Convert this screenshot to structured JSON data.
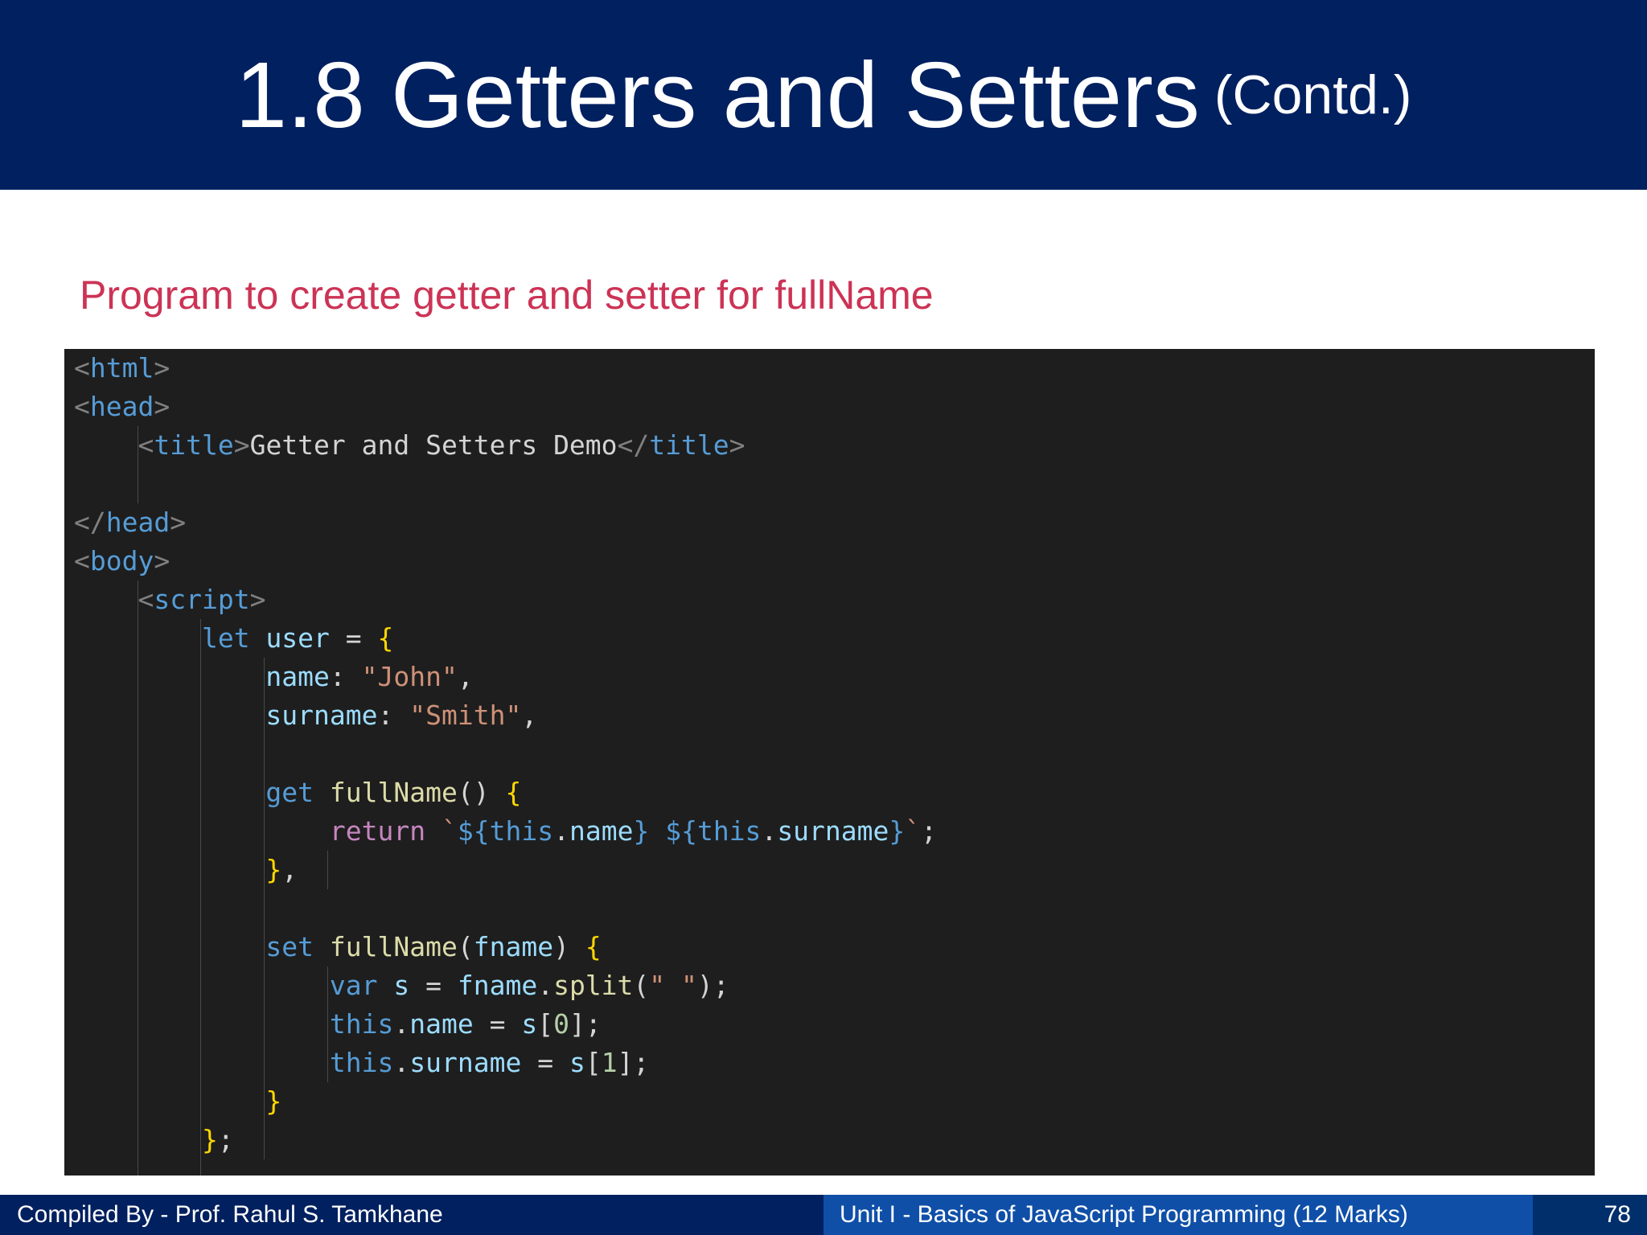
{
  "slide": {
    "title": "1.8 Getters and Setters",
    "title_suffix": "(Contd.)",
    "subtitle": "Program to create getter and setter for fullName"
  },
  "code": {
    "lines": [
      [
        {
          "t": "<",
          "c": "bracket"
        },
        {
          "t": "html",
          "c": "tag"
        },
        {
          "t": ">",
          "c": "bracket"
        }
      ],
      [
        {
          "t": "<",
          "c": "bracket"
        },
        {
          "t": "head",
          "c": "tag"
        },
        {
          "t": ">",
          "c": "bracket"
        }
      ],
      [
        {
          "t": "    ",
          "c": "text"
        },
        {
          "t": "<",
          "c": "bracket"
        },
        {
          "t": "title",
          "c": "tag"
        },
        {
          "t": ">",
          "c": "bracket"
        },
        {
          "t": "Getter and Setters Demo",
          "c": "text"
        },
        {
          "t": "</",
          "c": "bracket"
        },
        {
          "t": "title",
          "c": "tag"
        },
        {
          "t": ">",
          "c": "bracket"
        }
      ],
      [],
      [
        {
          "t": "</",
          "c": "bracket"
        },
        {
          "t": "head",
          "c": "tag"
        },
        {
          "t": ">",
          "c": "bracket"
        }
      ],
      [
        {
          "t": "<",
          "c": "bracket"
        },
        {
          "t": "body",
          "c": "tag"
        },
        {
          "t": ">",
          "c": "bracket"
        }
      ],
      [
        {
          "t": "    ",
          "c": "text"
        },
        {
          "t": "<",
          "c": "bracket"
        },
        {
          "t": "script",
          "c": "tag"
        },
        {
          "t": ">",
          "c": "bracket"
        }
      ],
      [
        {
          "t": "        ",
          "c": "text"
        },
        {
          "t": "let",
          "c": "kw"
        },
        {
          "t": " ",
          "c": "text"
        },
        {
          "t": "user",
          "c": "var"
        },
        {
          "t": " = ",
          "c": "punc"
        },
        {
          "t": "{",
          "c": "brace"
        }
      ],
      [
        {
          "t": "            ",
          "c": "text"
        },
        {
          "t": "name",
          "c": "var"
        },
        {
          "t": ": ",
          "c": "punc"
        },
        {
          "t": "\"John\"",
          "c": "str"
        },
        {
          "t": ",",
          "c": "punc"
        }
      ],
      [
        {
          "t": "            ",
          "c": "text"
        },
        {
          "t": "surname",
          "c": "var"
        },
        {
          "t": ": ",
          "c": "punc"
        },
        {
          "t": "\"Smith\"",
          "c": "str"
        },
        {
          "t": ",",
          "c": "punc"
        }
      ],
      [],
      [
        {
          "t": "            ",
          "c": "text"
        },
        {
          "t": "get",
          "c": "kw"
        },
        {
          "t": " ",
          "c": "text"
        },
        {
          "t": "fullName",
          "c": "fn"
        },
        {
          "t": "() ",
          "c": "punc"
        },
        {
          "t": "{",
          "c": "brace"
        }
      ],
      [
        {
          "t": "                ",
          "c": "text"
        },
        {
          "t": "return",
          "c": "ctrl"
        },
        {
          "t": " ",
          "c": "text"
        },
        {
          "t": "`",
          "c": "str"
        },
        {
          "t": "${",
          "c": "tpl"
        },
        {
          "t": "this",
          "c": "kw"
        },
        {
          "t": ".",
          "c": "punc"
        },
        {
          "t": "name",
          "c": "var"
        },
        {
          "t": "}",
          "c": "tpl"
        },
        {
          "t": " ",
          "c": "str"
        },
        {
          "t": "${",
          "c": "tpl"
        },
        {
          "t": "this",
          "c": "kw"
        },
        {
          "t": ".",
          "c": "punc"
        },
        {
          "t": "surname",
          "c": "var"
        },
        {
          "t": "}",
          "c": "tpl"
        },
        {
          "t": "`",
          "c": "str"
        },
        {
          "t": ";",
          "c": "punc"
        }
      ],
      [
        {
          "t": "            ",
          "c": "text"
        },
        {
          "t": "}",
          "c": "brace"
        },
        {
          "t": ",",
          "c": "punc"
        }
      ],
      [],
      [
        {
          "t": "            ",
          "c": "text"
        },
        {
          "t": "set",
          "c": "kw"
        },
        {
          "t": " ",
          "c": "text"
        },
        {
          "t": "fullName",
          "c": "fn"
        },
        {
          "t": "(",
          "c": "punc"
        },
        {
          "t": "fname",
          "c": "var"
        },
        {
          "t": ") ",
          "c": "punc"
        },
        {
          "t": "{",
          "c": "brace"
        }
      ],
      [
        {
          "t": "                ",
          "c": "text"
        },
        {
          "t": "var",
          "c": "kw"
        },
        {
          "t": " ",
          "c": "text"
        },
        {
          "t": "s",
          "c": "var"
        },
        {
          "t": " = ",
          "c": "punc"
        },
        {
          "t": "fname",
          "c": "var"
        },
        {
          "t": ".",
          "c": "punc"
        },
        {
          "t": "split",
          "c": "fn"
        },
        {
          "t": "(",
          "c": "punc"
        },
        {
          "t": "\" \"",
          "c": "str"
        },
        {
          "t": ");",
          "c": "punc"
        }
      ],
      [
        {
          "t": "                ",
          "c": "text"
        },
        {
          "t": "this",
          "c": "kw"
        },
        {
          "t": ".",
          "c": "punc"
        },
        {
          "t": "name",
          "c": "var"
        },
        {
          "t": " = ",
          "c": "punc"
        },
        {
          "t": "s",
          "c": "var"
        },
        {
          "t": "[",
          "c": "punc"
        },
        {
          "t": "0",
          "c": "num"
        },
        {
          "t": "];",
          "c": "punc"
        }
      ],
      [
        {
          "t": "                ",
          "c": "text"
        },
        {
          "t": "this",
          "c": "kw"
        },
        {
          "t": ".",
          "c": "punc"
        },
        {
          "t": "surname",
          "c": "var"
        },
        {
          "t": " = ",
          "c": "punc"
        },
        {
          "t": "s",
          "c": "var"
        },
        {
          "t": "[",
          "c": "punc"
        },
        {
          "t": "1",
          "c": "num"
        },
        {
          "t": "];",
          "c": "punc"
        }
      ],
      [
        {
          "t": "            ",
          "c": "text"
        },
        {
          "t": "}",
          "c": "brace"
        }
      ],
      [
        {
          "t": "        ",
          "c": "text"
        },
        {
          "t": "}",
          "c": "brace"
        },
        {
          "t": ";",
          "c": "punc"
        }
      ]
    ]
  },
  "footer": {
    "author": "Compiled By - Prof. Rahul S. Tamkhane",
    "unit": "Unit  I - Basics of JavaScript Programming (12 Marks)",
    "page_number": "78"
  }
}
